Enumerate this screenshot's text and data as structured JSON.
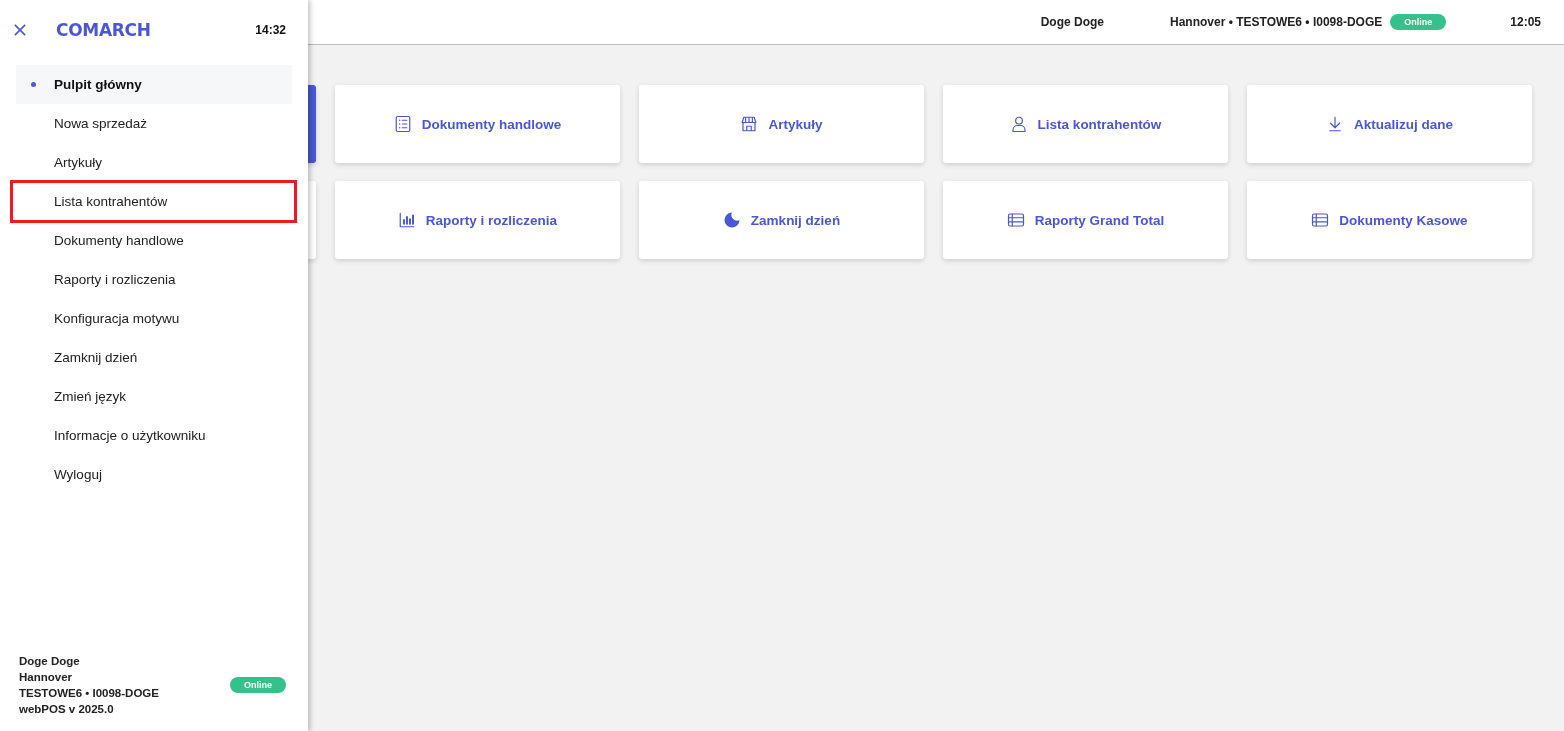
{
  "top_bar": {
    "user": "Doge Doge",
    "location": "Hannover • TESTOWE6 • I0098-DOGE",
    "status": "Online",
    "time": "12:05"
  },
  "hidden_tiles": [
    {
      "selected": true
    },
    {
      "selected": false
    }
  ],
  "tiles": [
    {
      "label": "Dokumenty handlowe",
      "kind": "list"
    },
    {
      "label": "Artykuły",
      "kind": "store"
    },
    {
      "label": "Lista kontrahentów",
      "kind": "person"
    },
    {
      "label": "Aktualizuj dane",
      "kind": "download"
    },
    {
      "label": "Raporty i rozliczenia",
      "kind": "chart"
    },
    {
      "label": "Zamknij dzień",
      "kind": "moon"
    },
    {
      "label": "Raporty Grand Total",
      "kind": "table"
    },
    {
      "label": "Dokumenty Kasowe",
      "kind": "table"
    }
  ],
  "drawer": {
    "logo": "COMARCH",
    "time": "14:32",
    "items": [
      {
        "label": "Pulpit główny",
        "selected": true,
        "highlighted": false
      },
      {
        "label": "Nowa sprzedaż",
        "selected": false,
        "highlighted": false
      },
      {
        "label": "Artykuły",
        "selected": false,
        "highlighted": false
      },
      {
        "label": "Lista kontrahentów",
        "selected": false,
        "highlighted": true
      },
      {
        "label": "Dokumenty handlowe",
        "selected": false,
        "highlighted": false
      },
      {
        "label": "Raporty i rozliczenia",
        "selected": false,
        "highlighted": false
      },
      {
        "label": "Konfiguracja motywu",
        "selected": false,
        "highlighted": false
      },
      {
        "label": "Zamknij dzień",
        "selected": false,
        "highlighted": false
      },
      {
        "label": "Zmień język",
        "selected": false,
        "highlighted": false
      },
      {
        "label": "Informacje o użytkowniku",
        "selected": false,
        "highlighted": false
      },
      {
        "label": "Wyloguj",
        "selected": false,
        "highlighted": false
      }
    ],
    "footer": {
      "lines": [
        "Doge Doge",
        "Hannover",
        "TESTOWE6 • I0098-DOGE",
        "webPOS v 2025.0"
      ],
      "status": "Online"
    }
  }
}
